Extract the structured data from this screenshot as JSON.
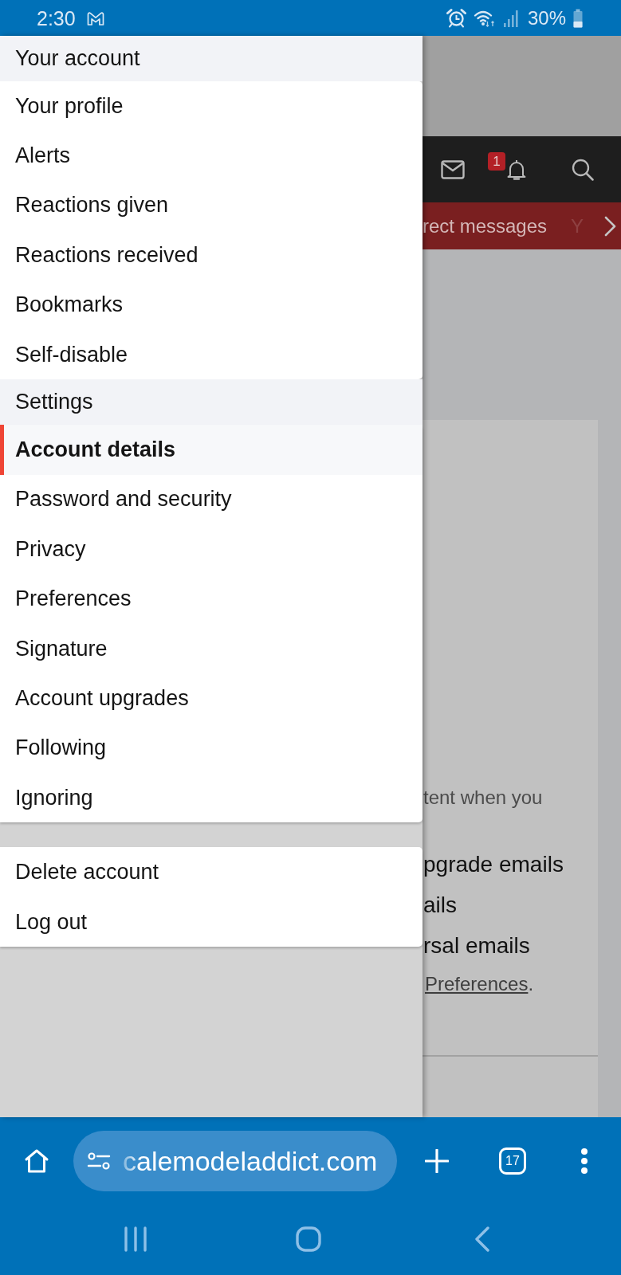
{
  "status_bar": {
    "time": "2:30",
    "battery": "30%"
  },
  "menu": {
    "sections": [
      {
        "title": "Your account",
        "items": [
          {
            "label": "Your profile",
            "selected": false
          },
          {
            "label": "Alerts",
            "selected": false
          },
          {
            "label": "Reactions given",
            "selected": false
          },
          {
            "label": "Reactions received",
            "selected": false
          },
          {
            "label": "Bookmarks",
            "selected": false
          },
          {
            "label": "Self-disable",
            "selected": false
          }
        ]
      },
      {
        "title": "Settings",
        "items": [
          {
            "label": "Account details",
            "selected": true
          },
          {
            "label": "Password and security",
            "selected": false
          },
          {
            "label": "Privacy",
            "selected": false
          },
          {
            "label": "Preferences",
            "selected": false
          },
          {
            "label": "Signature",
            "selected": false
          },
          {
            "label": "Account upgrades",
            "selected": false
          },
          {
            "label": "Following",
            "selected": false
          },
          {
            "label": "Ignoring",
            "selected": false
          }
        ]
      },
      {
        "items": [
          {
            "label": "Delete account",
            "selected": false
          },
          {
            "label": "Log out",
            "selected": false
          }
        ]
      }
    ]
  },
  "page_behind": {
    "header": {
      "alert_badge": "1"
    },
    "nav_tabs": [
      {
        "label": "rect messages",
        "faded": false
      },
      {
        "label": "Y",
        "faded": true
      }
    ],
    "card": {
      "lines": [
        {
          "kind": "hint",
          "text": "tent when you"
        },
        {
          "kind": "option",
          "text": "pgrade emails"
        },
        {
          "kind": "option",
          "text": "ails"
        },
        {
          "kind": "option",
          "text": "rsal emails"
        },
        {
          "kind": "link_line",
          "link": "Preferences",
          "text": "."
        }
      ]
    }
  },
  "browser": {
    "url": "calemodeladdict.com",
    "tab_count": "17"
  }
}
